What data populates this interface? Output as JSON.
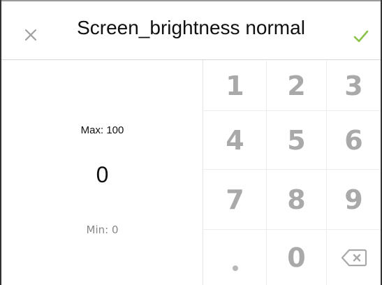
{
  "header": {
    "title": "Screen_brightness normal",
    "close_icon": "close-icon",
    "confirm_icon": "checkmark-icon"
  },
  "value_panel": {
    "max_label": "Max: 100",
    "value": "0",
    "min_label": "Min: 0"
  },
  "keypad": {
    "keys": [
      "1",
      "2",
      "3",
      "4",
      "5",
      "6",
      "7",
      "8",
      "9",
      ".",
      "0",
      "backspace"
    ],
    "backspace_icon": "backspace-icon"
  },
  "colors": {
    "accent_check": "#8bc34a",
    "close_icon": "#a0a0a0",
    "key_text": "#a9a9a9"
  }
}
